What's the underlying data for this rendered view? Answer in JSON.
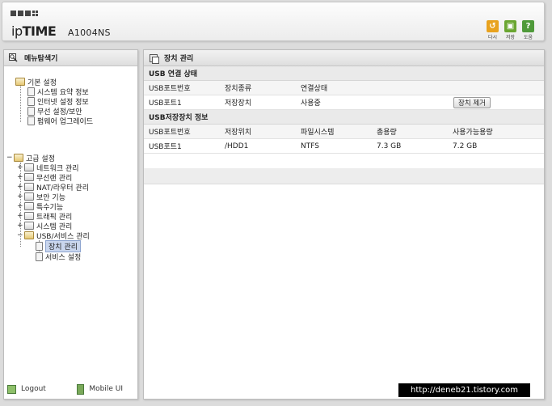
{
  "header": {
    "brand_light": "ip",
    "brand_bold": "TIME",
    "model": "A1004NS",
    "buttons": [
      {
        "label": "다시",
        "icon": "undo-icon",
        "color": "#e8a21e"
      },
      {
        "label": "저장",
        "icon": "save-icon",
        "color": "#6aa631"
      },
      {
        "label": "도움",
        "icon": "help-icon",
        "color": "#4f9a3a"
      }
    ]
  },
  "sidebar": {
    "title": "메뉴탐색기",
    "basic": {
      "label": "기본 설정",
      "items": [
        "시스템 요약 정보",
        "인터넷 설정 정보",
        "무선 설정/보안",
        "펌웨어 업그레이드"
      ]
    },
    "advanced": {
      "label": "고급 설정",
      "items": [
        {
          "label": "네트워크 관리",
          "toggle": "+"
        },
        {
          "label": "무선랜 관리",
          "toggle": "+"
        },
        {
          "label": "NAT/라우터 관리",
          "toggle": "+"
        },
        {
          "label": "보안 기능",
          "toggle": "+"
        },
        {
          "label": "특수기능",
          "toggle": "+"
        },
        {
          "label": "트래픽 관리",
          "toggle": "+"
        },
        {
          "label": "시스템 관리",
          "toggle": "+"
        },
        {
          "label": "USB/서비스 관리",
          "toggle": "−"
        }
      ],
      "usb_children": [
        "장치 관리",
        "서비스 설정"
      ]
    },
    "footer": {
      "logout": "Logout",
      "mobile": "Mobile UI"
    }
  },
  "main": {
    "title": "장치 관리",
    "usb_status": {
      "section": "USB 연결 상태",
      "headers": [
        "USB포트번호",
        "장치종류",
        "연결상태"
      ],
      "row": [
        "USB포트1",
        "저장장치",
        "사용중"
      ],
      "remove_button": "장치 제거"
    },
    "storage": {
      "section": "USB저장장치 정보",
      "headers": [
        "USB포트번호",
        "저장위치",
        "파일시스템",
        "총용량",
        "사용가능용량"
      ],
      "row": [
        "USB포트1",
        "/HDD1",
        "NTFS",
        "7.3 GB",
        "7.2 GB"
      ]
    }
  },
  "watermark": "http://deneb21.tistory.com",
  "colors": {
    "accent": "#c9d6ee",
    "panel": "#ffffff",
    "background": "#dcdcdc"
  }
}
